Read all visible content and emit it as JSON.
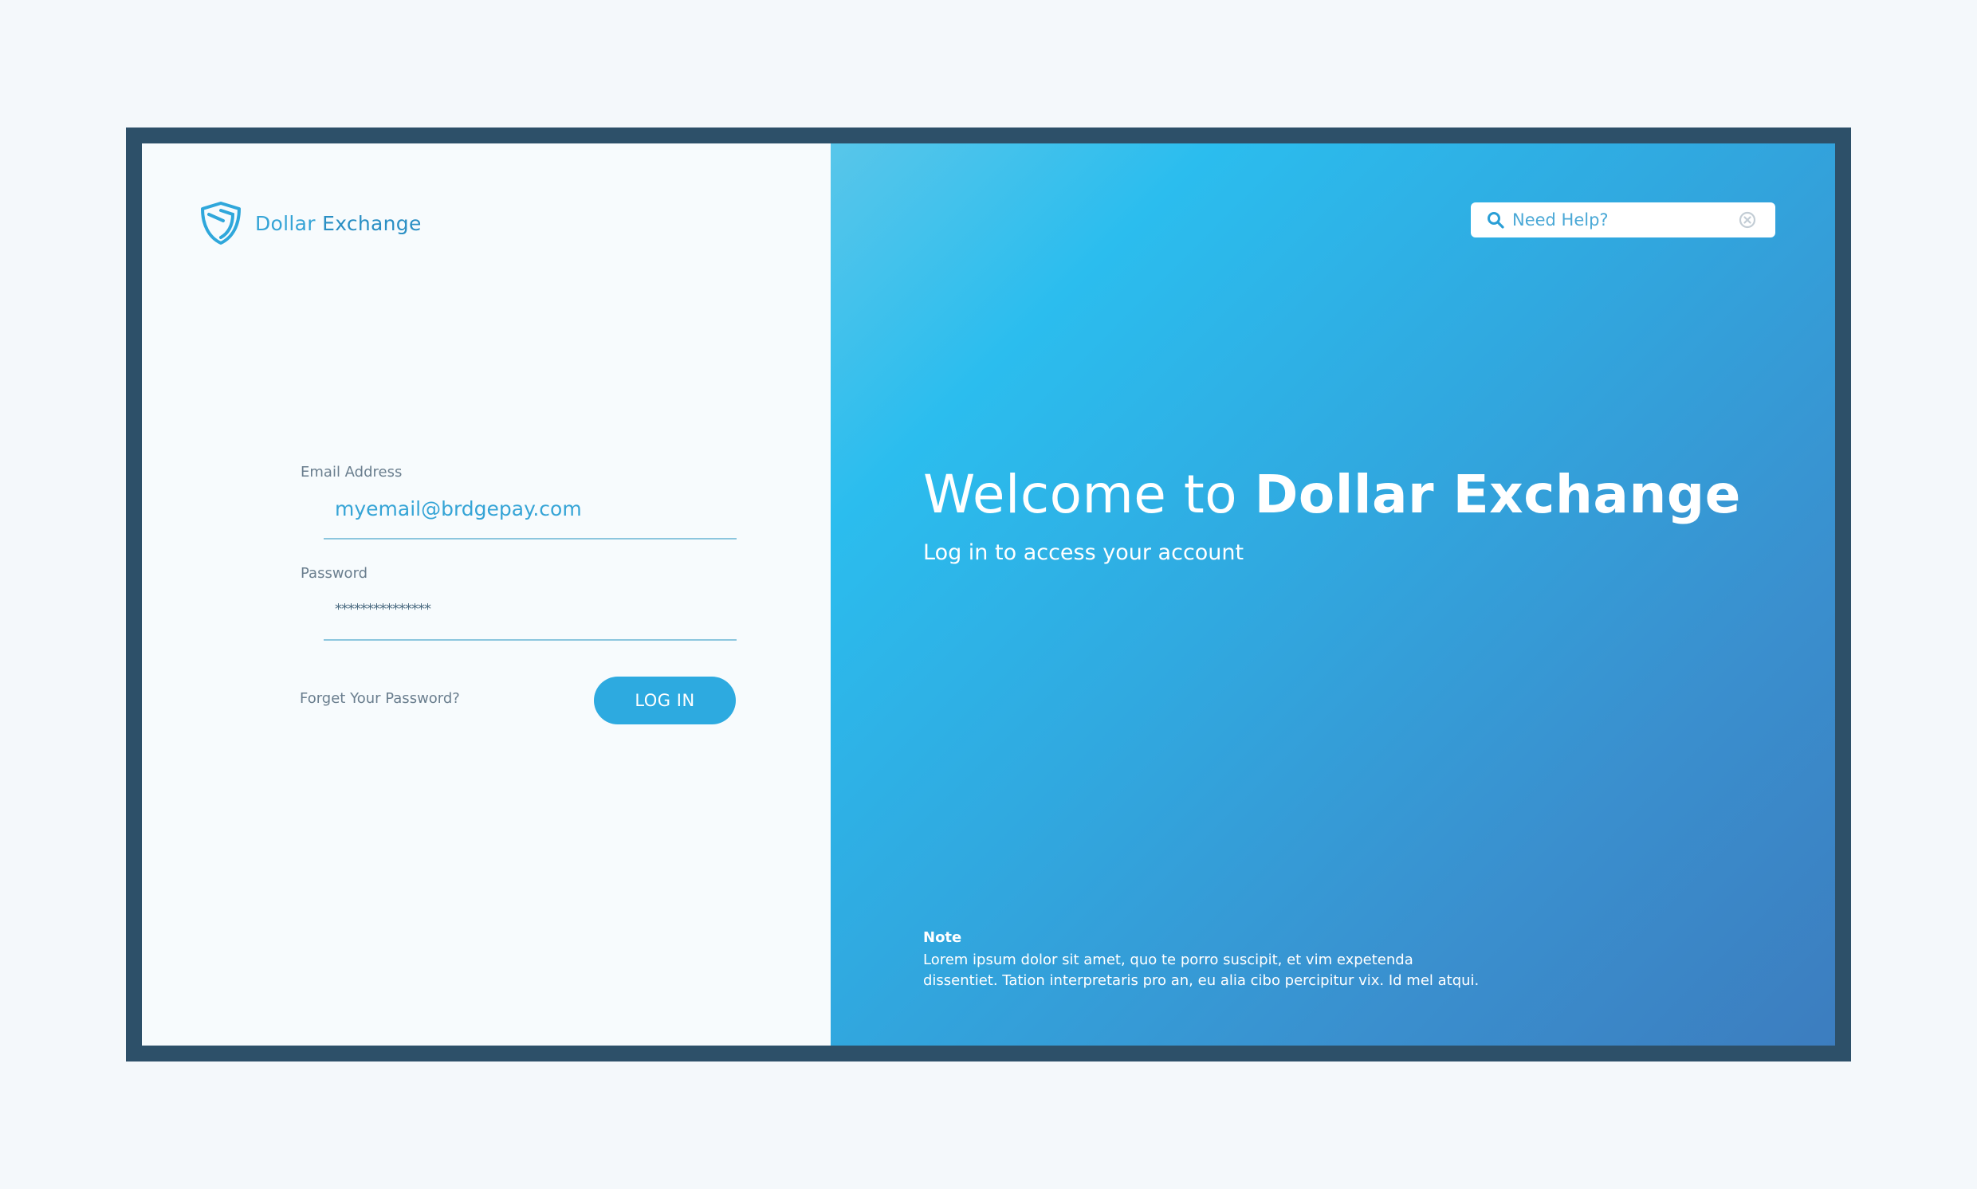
{
  "brand": {
    "name_part1": "Dollar",
    "name_part2": "Exchange"
  },
  "login_form": {
    "email_label": "Email Address",
    "email_value": "myemail@brdgepay.com",
    "password_label": "Password",
    "password_value": "***************",
    "forgot_link": "Forget Your Password?",
    "login_button": "LOG IN"
  },
  "search": {
    "placeholder": "Need Help?",
    "icon": "search-icon",
    "clear_icon": "close-circle-icon"
  },
  "welcome": {
    "prefix": "Welcome to",
    "brand": "Dollar Exchange",
    "subtitle": "Log in to access your account"
  },
  "note": {
    "title": "Note",
    "line1": "Lorem ipsum dolor sit amet, quo te porro suscipit, et vim expetenda",
    "line2": "dissentiet. Tation interpretaris pro an, eu alia cibo percipitur vix. Id mel atqui."
  },
  "colors": {
    "frame": "#2d5069",
    "accent": "#2daae0",
    "left_bg": "#f7fbfd",
    "gradient_start": "#2bbdee",
    "gradient_end": "#3c7dbf"
  }
}
